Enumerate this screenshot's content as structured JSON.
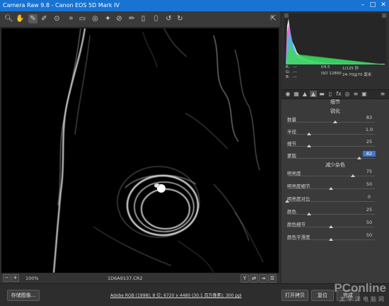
{
  "title_bar": {
    "title": "Camera Raw 9.8 -  Canon EOS 5D Mark IV",
    "minimize": "–",
    "maximize": "□",
    "close": "✕"
  },
  "toolbar": {
    "tools": [
      "zoom-tool",
      "hand-tool",
      "white-balance-tool",
      "color-sampler-tool",
      "targeted-adjustment-tool",
      "crop-tool",
      "straighten-tool",
      "spot-removal-tool",
      "red-eye-tool",
      "adjustment-brush-tool",
      "graduated-filter-tool",
      "radial-filter-tool",
      "open-preferences",
      "rotate-ccw",
      "rotate-cw"
    ]
  },
  "histogram": {
    "r_label": "R:",
    "g_label": "G:",
    "b_label": "B:",
    "r_value": "---",
    "g_value": "---",
    "b_value": "---",
    "aperture": "f/4.5",
    "shutter": "1/125 秒",
    "iso": "ISO 12800",
    "lens": "24-70@70 毫米"
  },
  "panel": {
    "title": "细节",
    "sharpening": {
      "heading": "锐化",
      "rows": [
        {
          "label": "数量",
          "value": "83",
          "fraction": 0.55
        },
        {
          "label": "半径",
          "value": "1.0",
          "fraction": 0.25
        },
        {
          "label": "细节",
          "value": "25",
          "fraction": 0.25
        },
        {
          "label": "蒙版",
          "value": "82",
          "fraction": 0.82
        }
      ]
    },
    "noise_reduction": {
      "heading": "减少杂色",
      "rows": [
        {
          "label": "明亮度",
          "value": "75",
          "fraction": 0.75
        },
        {
          "label": "明亮度细节",
          "value": "50",
          "fraction": 0.5
        },
        {
          "label": "明亮度对比",
          "value": "0",
          "fraction": 0.0
        },
        {
          "label": "颜色",
          "value": "25",
          "fraction": 0.25
        },
        {
          "label": "颜色细节",
          "value": "50",
          "fraction": 0.5
        },
        {
          "label": "颜色平滑度",
          "value": "50",
          "fraction": 0.5
        }
      ]
    }
  },
  "status": {
    "zoom": "100%",
    "filename": "1D6A9137.CR2",
    "minus": "−",
    "plus": "+"
  },
  "bottom": {
    "save_button": "存储图像...",
    "workflow_link": "Adobe RGB (1998); 8 位; 6720 x 4480 (30.1 百万像素); 300 ppi",
    "open_copy_button": "打开拷贝",
    "reset_button": "复位",
    "done_button": "完成"
  },
  "watermark": {
    "brand": "PConline",
    "sub": "太平洋电脑网"
  },
  "colors": {
    "title_bar": "#1873d3",
    "selected_value": "#3c78d8"
  }
}
